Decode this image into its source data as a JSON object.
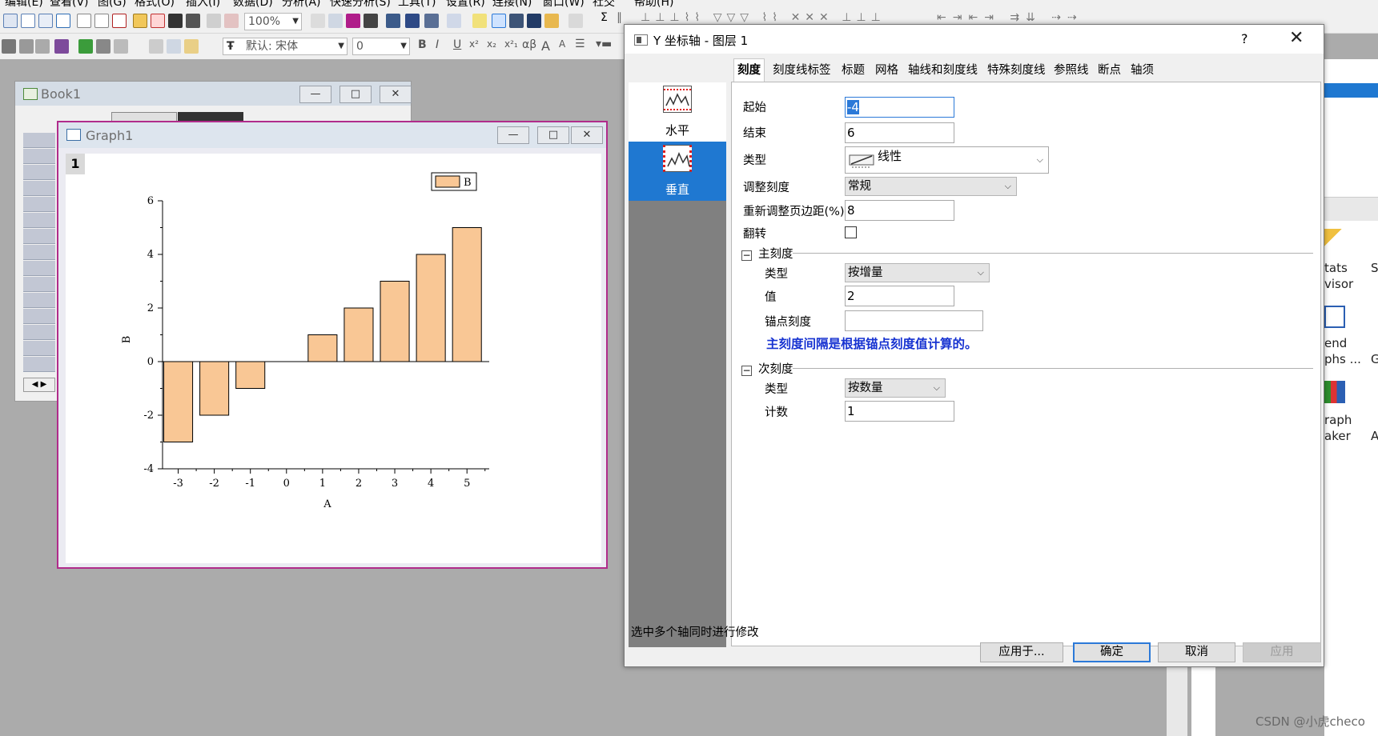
{
  "menubar": {
    "items": [
      "编辑(E)",
      "查看(V)",
      "图(G)",
      "格式(O)",
      "插入(I)",
      "数据(D)",
      "分析(A)",
      "快速分析(S)",
      "工具(T)",
      "设置(R)",
      "连接(N)",
      "窗口(W)",
      "社交",
      "帮助(H)"
    ]
  },
  "toolbar": {
    "zoom": "100%",
    "font_name": "默认: 宋体",
    "font_size": "0",
    "text_buttons": [
      "B",
      "I",
      "U",
      "x²",
      "x₂",
      "x²₁",
      "αβ",
      "A",
      "A"
    ]
  },
  "book1": {
    "title": "Book1"
  },
  "graph1": {
    "title": "Graph1",
    "layer_badge": "1"
  },
  "chart_data": {
    "type": "bar",
    "x": [
      -3,
      -2,
      -1,
      0,
      1,
      2,
      3,
      4,
      5
    ],
    "x_tick_labels": [
      "-3",
      "-2",
      "-1",
      "0",
      "1",
      "2",
      "3",
      "4",
      "5"
    ],
    "series": [
      {
        "name": "B",
        "values": [
          -3,
          -2,
          -1,
          0,
          1,
          2,
          3,
          4,
          5
        ],
        "color": "#f9c795"
      }
    ],
    "xlabel": "A",
    "ylabel": "B",
    "ylim": [
      -4,
      6
    ],
    "y_ticks": [
      -4,
      -2,
      0,
      2,
      4,
      6
    ],
    "y_tick_labels": [
      "-4",
      "-2",
      "0",
      "2",
      "4",
      "6"
    ],
    "legend_position": "top-right",
    "grid": false
  },
  "dialog": {
    "title": "Y 坐标轴 - 图层 1",
    "help": "?",
    "close": "✕",
    "side_items": [
      {
        "label": "水平",
        "selected": false
      },
      {
        "label": "垂直",
        "selected": true
      }
    ],
    "tabs": [
      "刻度",
      "刻度线标签",
      "标题",
      "网格",
      "轴线和刻度线",
      "特殊刻度线",
      "参照线",
      "断点",
      "轴须"
    ],
    "active_tab": "刻度",
    "fields": {
      "start_label": "起始",
      "start_value": "-4",
      "end_label": "结束",
      "end_value": "6",
      "type_label": "类型",
      "type_value": "线性",
      "rescale_label": "调整刻度",
      "rescale_value": "常规",
      "margin_label": "重新调整页边距(%)",
      "margin_value": "8",
      "reverse_label": "翻转",
      "reverse_checked": false
    },
    "major": {
      "section": "主刻度",
      "type_label": "类型",
      "type_value": "按增量",
      "value_label": "值",
      "value_value": "2",
      "anchor_label": "锚点刻度",
      "anchor_value": "",
      "note": "主刻度间隔是根据锚点刻度值计算的。"
    },
    "minor": {
      "section": "次刻度",
      "type_label": "类型",
      "type_value": "按数量",
      "count_label": "计数",
      "count_value": "1"
    },
    "status": "选中多个轴同时进行修改",
    "buttons": {
      "apply_to": "应用于...",
      "ok": "确定",
      "cancel": "取消",
      "apply": "应用"
    }
  },
  "right_pane": {
    "items": [
      {
        "line1": "tats",
        "line2": "visor"
      },
      {
        "line1": "end",
        "line2": "phs ..."
      },
      {
        "line1": "raph",
        "line2": "aker"
      }
    ],
    "edge_letters": [
      "S",
      "G",
      "A"
    ]
  },
  "watermark": "CSDN @小虎checo"
}
